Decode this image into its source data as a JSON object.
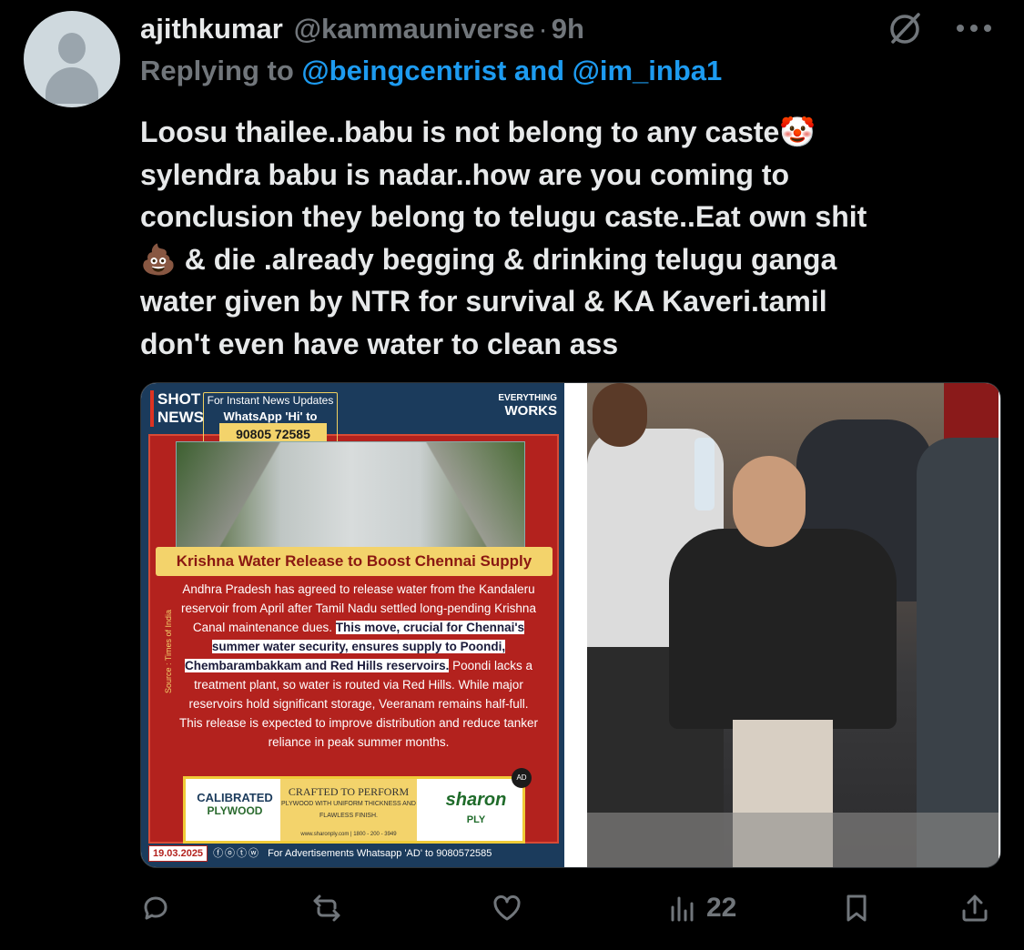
{
  "tweet": {
    "name": "ajithkumar",
    "handle": "@kammauniverse",
    "separator": "·",
    "time": "9h",
    "replying_prefix": "Replying to",
    "replying_mention1": "@beingcentrist",
    "replying_and": "and",
    "replying_mention2": "@im_inba1",
    "text": "Loosu thailee..babu is not belong to any caste🤡\nsylendra babu is nadar..how are you coming to\nconclusion they belong to telugu caste..Eat own shit\n💩 & die .already begging & drinking telugu ganga\nwater given by NTR for survival & KA Kaveri.tamil\ndon't even have water to clean ass"
  },
  "news_card": {
    "logo": "SHOT NEWS",
    "wa_line1": "For Instant News Updates",
    "wa_line2": "WhatsApp 'Hi' to",
    "wa_phone": "90805 72585",
    "everything": "EVERYTHING",
    "works": "WORKS",
    "headline": "Krishna Water Release to Boost Chennai Supply",
    "source": "Source : Times of India",
    "body_part1": "Andhra Pradesh has agreed to release water from the Kandaleru reservoir from April after Tamil Nadu settled long-pending Krishna Canal maintenance dues. ",
    "body_highlight": "This move, crucial for Chennai's summer water security, ensures supply to Poondi, Chembarambakkam and Red Hills reservoirs.",
    "body_part2": " Poondi lacks a treatment plant, so water is routed via Red Hills. While major reservoirs hold significant storage, Veeranam remains half-full. This release is expected to improve distribution and reduce tanker reliance in peak summer months.",
    "ad_calibrated": "CALIBRATED",
    "ad_plywood": "PLYWOOD",
    "ad_crafted": "CRAFTED TO PERFORM",
    "ad_crafted_sub": "PLYWOOD WITH UNIFORM THICKNESS AND FLAWLESS FINISH.",
    "ad_url": "www.sharonply.com | 1800 - 200 - 3949",
    "ad_sharon": "sharon",
    "ad_ply": "PLY",
    "ad_badge": "AD",
    "date": "19.03.2025",
    "social": "ⓕⓞⓣⓦ",
    "ads_text": "For Advertisements Whatsapp 'AD' to 9080572585"
  },
  "actions": {
    "reply_count": "",
    "retweet_count": "",
    "like_count": "",
    "views_count": "22"
  },
  "colors": {
    "background": "#000000",
    "text": "#e7e9ea",
    "muted": "#71767b",
    "link": "#1d9bf0"
  }
}
